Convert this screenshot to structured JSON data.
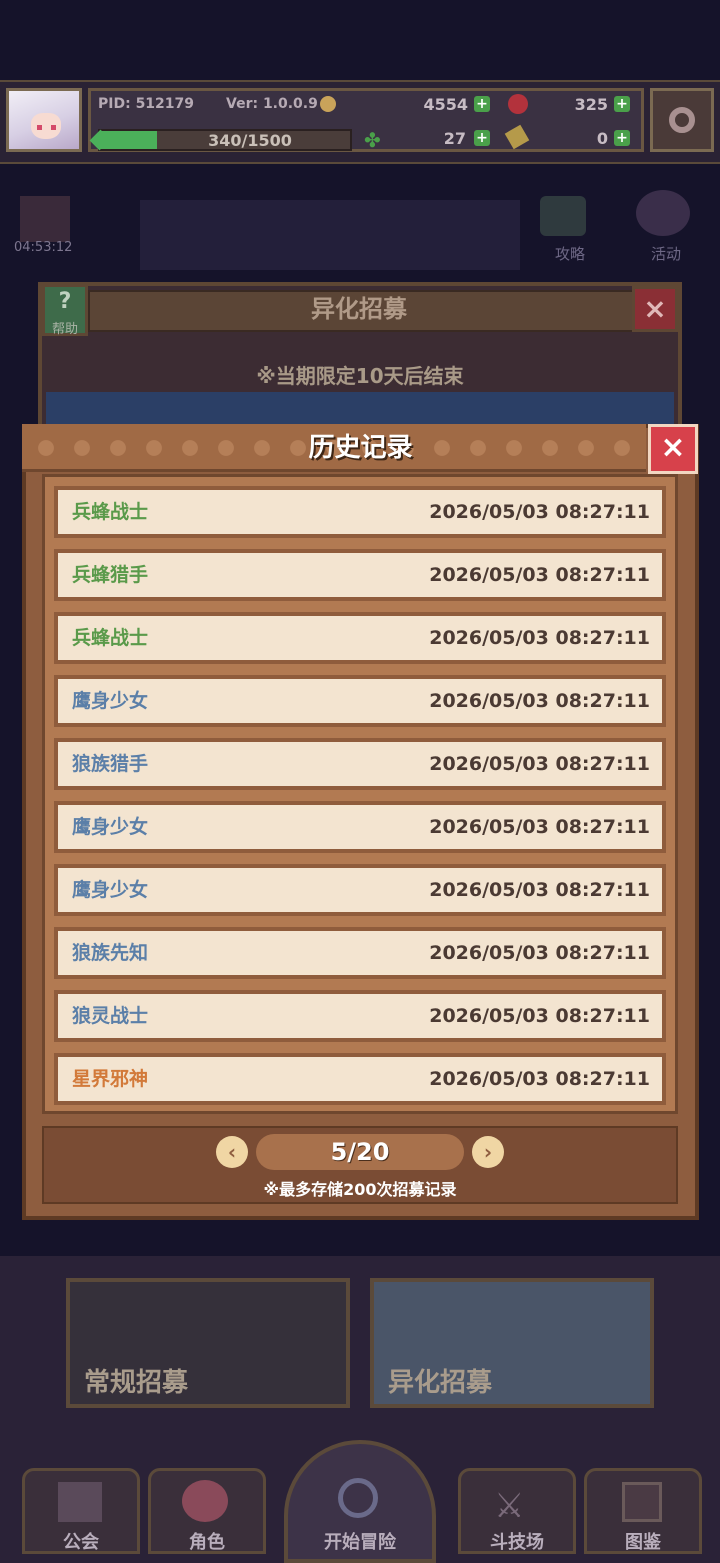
{
  "status": {
    "pid": "PID: 512179",
    "version": "Ver: 1.0.0.9",
    "exp": "340/1500",
    "exp_progress": 0.227,
    "gold": "4554",
    "gems": "325",
    "clovers": "27",
    "keys": "0"
  },
  "scene": {
    "timer": "04:53:12",
    "guide": "攻略",
    "event": "活动"
  },
  "recruit": {
    "title": "异化招募",
    "help": "帮助",
    "notice": "※当期限定10天后结束"
  },
  "history": {
    "title": "历史记录",
    "records": [
      {
        "name": "兵蜂战士",
        "time": "2026/05/03 08:27:11",
        "color": "#5a9a4a"
      },
      {
        "name": "兵蜂猎手",
        "time": "2026/05/03 08:27:11",
        "color": "#5a9a4a"
      },
      {
        "name": "兵蜂战士",
        "time": "2026/05/03 08:27:11",
        "color": "#5a9a4a"
      },
      {
        "name": "鹰身少女",
        "time": "2026/05/03 08:27:11",
        "color": "#5b7fa8"
      },
      {
        "name": "狼族猎手",
        "time": "2026/05/03 08:27:11",
        "color": "#5b7fa8"
      },
      {
        "name": "鹰身少女",
        "time": "2026/05/03 08:27:11",
        "color": "#5b7fa8"
      },
      {
        "name": "鹰身少女",
        "time": "2026/05/03 08:27:11",
        "color": "#5b7fa8"
      },
      {
        "name": "狼族先知",
        "time": "2026/05/03 08:27:11",
        "color": "#5b7fa8"
      },
      {
        "name": "狼灵战士",
        "time": "2026/05/03 08:27:11",
        "color": "#5b7fa8"
      },
      {
        "name": "星界邪神",
        "time": "2026/05/03 08:27:11",
        "color": "#d27a3a"
      }
    ],
    "page": "5/20",
    "note": "※最多存储200次招募记录"
  },
  "banners": {
    "normal": "常规招募",
    "special": "异化招募"
  },
  "nav": {
    "guild": "公会",
    "character": "角色",
    "adventure": "开始冒险",
    "arena": "斗技场",
    "codex": "图鉴"
  }
}
